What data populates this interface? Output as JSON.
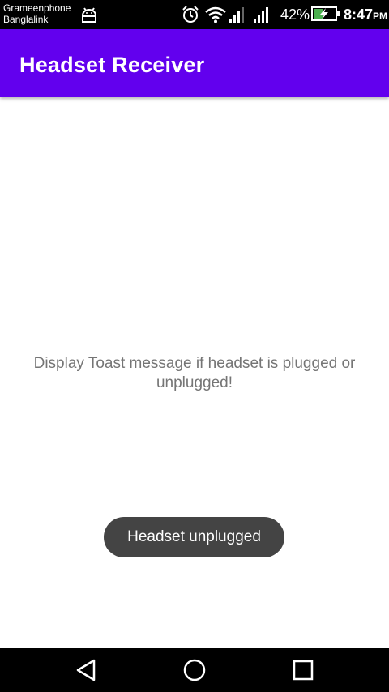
{
  "status_bar": {
    "carrier_1": "Grameenphone",
    "carrier_2": "Banglalink",
    "battery_percent": "42%",
    "time": "8:47",
    "time_suffix": "PM",
    "icons": [
      "android-debug-icon",
      "alarm-icon",
      "wifi-icon",
      "signal-icon",
      "signal-icon",
      "battery-charging-icon"
    ]
  },
  "app_bar": {
    "title": "Headset Receiver",
    "color": "#6200ee"
  },
  "main": {
    "message": "Display Toast message if headset is plugged or unplugged!"
  },
  "toast": {
    "text": "Headset unplugged"
  },
  "nav_bar": {
    "icons": [
      "back-icon",
      "home-icon",
      "recent-apps-icon"
    ]
  }
}
